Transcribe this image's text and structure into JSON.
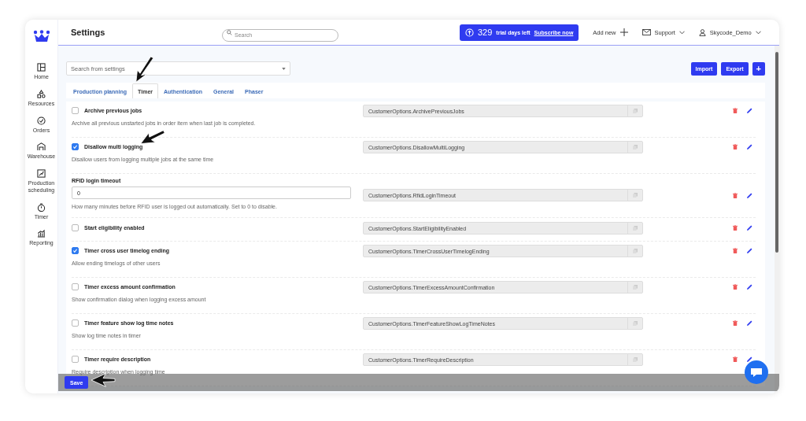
{
  "sidebar": {
    "items": [
      {
        "label": "Home"
      },
      {
        "label": "Resources"
      },
      {
        "label": "Orders"
      },
      {
        "label": "Warehouse"
      },
      {
        "label": "Production scheduling"
      },
      {
        "label": "Timer"
      },
      {
        "label": "Reporting"
      }
    ]
  },
  "header": {
    "title": "Settings",
    "search_placeholder": "Search",
    "trial": {
      "days": "329",
      "text": "trial days left",
      "link": "Subscribe now"
    },
    "add_new": "Add new",
    "support": "Support",
    "user": "Skycode_Demo"
  },
  "toolbar": {
    "search_placeholder": "Search from settings",
    "buttons": [
      "Import",
      "Export",
      "+"
    ]
  },
  "tabs": [
    {
      "label": "Production planning",
      "selected": false
    },
    {
      "label": "Timer",
      "selected": true
    },
    {
      "label": "Authentication",
      "selected": false
    },
    {
      "label": "General",
      "selected": false
    },
    {
      "label": "Phaser",
      "selected": false
    }
  ],
  "settings": [
    {
      "kind": "checkbox",
      "label": "Archive previous jobs",
      "checked": false,
      "description": "Archive all previous unstarted jobs in order item when last job is completed.",
      "key": "CustomerOptions.ArchivePreviousJobs"
    },
    {
      "kind": "checkbox",
      "label": "Disallow multi logging",
      "checked": true,
      "description": "Disallow users from logging multiple jobs at the same time",
      "key": "CustomerOptions.DisallowMultiLogging"
    },
    {
      "kind": "number",
      "label": "RFID login timeout",
      "value": "0",
      "description": "How many minutes before RFID user is logged out automatically. Set to 0 to disable.",
      "key": "CustomerOptions.RfidLoginTimeout"
    },
    {
      "kind": "checkbox",
      "label": "Start eligibility enabled",
      "checked": false,
      "key": "CustomerOptions.StartEligibilityEnabled"
    },
    {
      "kind": "checkbox",
      "label": "Timer cross user timelog ending",
      "checked": true,
      "description": "Allow ending timelogs of other users",
      "key": "CustomerOptions.TimerCrossUserTimelogEnding"
    },
    {
      "kind": "checkbox",
      "label": "Timer excess amount confirmation",
      "checked": false,
      "description": "Show confirmation dialog when logging excess amount",
      "key": "CustomerOptions.TimerExcessAmountConfirmation"
    },
    {
      "kind": "checkbox",
      "label": "Timer feature show log time notes",
      "checked": false,
      "description": "Show log time notes in timer",
      "key": "CustomerOptions.TimerFeatureShowLogTimeNotes"
    },
    {
      "kind": "checkbox",
      "label": "Timer require description",
      "checked": false,
      "description": "Require description when logging time",
      "key": "CustomerOptions.TimerRequireDescription"
    }
  ],
  "save_button": "Save"
}
